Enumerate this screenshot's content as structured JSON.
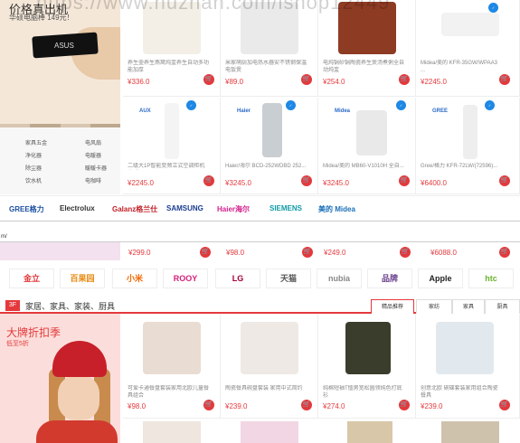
{
  "banner1": {
    "title": "价格真出机",
    "subtitle": "华硕电脑棒 149元！",
    "stick_logo": "ASUS"
  },
  "categories1": [
    "家具五金",
    "电风扇",
    "净化器",
    "电暖器",
    "除尘器",
    "暖暖卡器",
    "饮水机",
    "电咖啡"
  ],
  "row1": [
    {
      "name": "养生壶养生燕窝炖盅养生自动多功能加厚",
      "price": "¥336.0"
    },
    {
      "name": "米家萌厨加电热水器安不锈钢保温电饭煲",
      "price": "¥89.0"
    },
    {
      "name": "电炖锅砂锅陶瓷养生煲汤煮粥全自动炖盅",
      "price": "¥254.0"
    },
    {
      "name": "Midea/美的 KFR-35GW/WPAA3 ...",
      "price": "¥2245.0"
    }
  ],
  "row2": [
    {
      "name": "二级大1P智能变频立式空调柜机冷暖",
      "price": "¥2245.0",
      "brand": "AUX"
    },
    {
      "name": "Haier/海尔 BCD-252WDBD 252...",
      "price": "¥3245.0",
      "brand": "Haier"
    },
    {
      "name": "Midea/美的 MB60-V1010H 全自...",
      "price": "¥3245.0",
      "brand": "Midea"
    },
    {
      "name": "Gree/格力 KFR-72LW/(72596)...",
      "price": "¥6400.0",
      "brand": "GREE"
    }
  ],
  "brands1": [
    "GREE格力",
    "Electrolux",
    "Galanz格兰仕",
    "SAMSUNG",
    "Haier海尔",
    "SIEMENS",
    "美的 Midea"
  ],
  "urlbar": {
    "text": "m/"
  },
  "pricerow": [
    "¥299.0",
    "¥98.0",
    "¥249.0",
    "¥6088.0"
  ],
  "logos": [
    "金立",
    "百果园",
    "小米",
    "ROOY",
    "LG",
    "天猫",
    "nubia",
    "品牌",
    "Apple",
    "htc"
  ],
  "section": {
    "num": "3F",
    "title": "家居、家具、家装、厨具",
    "tabs": [
      "精品推荐",
      "家纺",
      "家具",
      "厨具"
    ]
  },
  "banner2": {
    "title": "大牌折扣季",
    "subtitle": "低至5折"
  },
  "row3": [
    {
      "name": "可爱卡通餐盘套装家用北欧儿童餐具组合",
      "price": "¥98.0"
    },
    {
      "name": "陶瓷餐具碗盘套装 家用中式简约",
      "price": "¥239.0"
    },
    {
      "name": "纯棉短袖T恤男宽松圆领纯色打底衫",
      "price": "¥274.0"
    },
    {
      "name": "创意北欧 碗碟套装家用组合陶瓷餐具",
      "price": "¥239.0"
    }
  ],
  "watermark": "https://www.huzhan.com/ishop12449",
  "colors": {
    "accent": "#e4393c"
  }
}
